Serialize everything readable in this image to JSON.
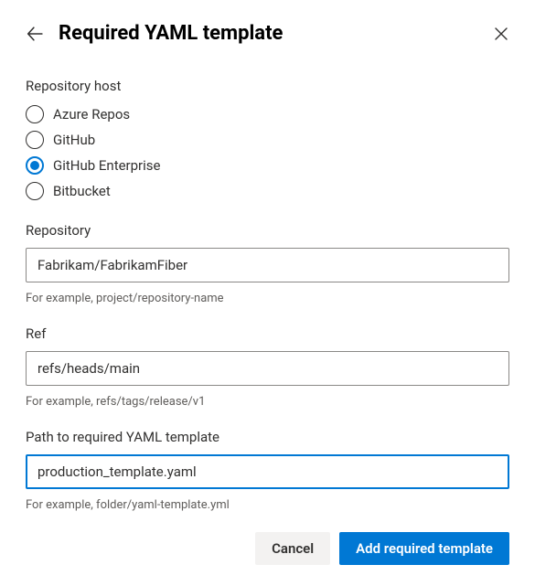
{
  "header": {
    "title": "Required YAML template"
  },
  "host": {
    "label": "Repository host",
    "options": [
      {
        "label": "Azure Repos",
        "selected": false
      },
      {
        "label": "GitHub",
        "selected": false
      },
      {
        "label": "GitHub Enterprise",
        "selected": true
      },
      {
        "label": "Bitbucket",
        "selected": false
      }
    ]
  },
  "repository": {
    "label": "Repository",
    "value": "Fabrikam/FabrikamFiber",
    "hint": "For example, project/repository-name"
  },
  "ref": {
    "label": "Ref",
    "value": "refs/heads/main",
    "hint": "For example, refs/tags/release/v1"
  },
  "path": {
    "label": "Path to required YAML template",
    "value": "production_template.yaml",
    "hint": "For example, folder/yaml-template.yml"
  },
  "footer": {
    "cancel": "Cancel",
    "submit": "Add required template"
  }
}
